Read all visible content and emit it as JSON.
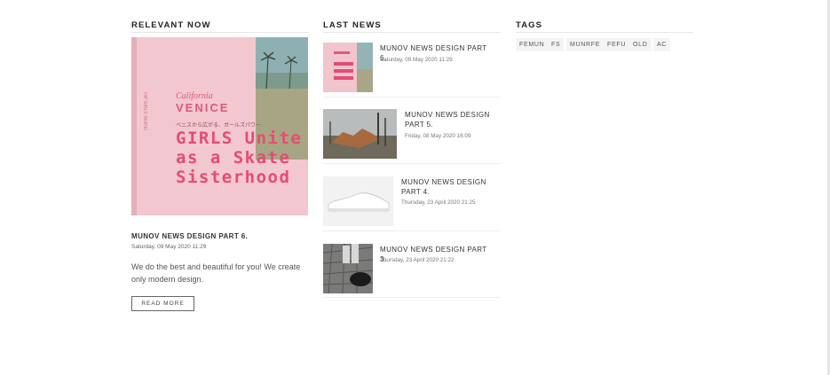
{
  "sections": {
    "relevant_title": "RELEVANT NOW",
    "last_news_title": "LAST NEWS",
    "tags_title": "TAGS"
  },
  "featured": {
    "image_text": {
      "city": "California",
      "venice": "VENICE",
      "sub": "ベニスから広がる、ガールズパワー",
      "headline": "GIRLS Unite\nas a Skate\nSisterhood",
      "side": "HIP GIRLS SKATE!"
    },
    "title": "MUNOV NEWS DESIGN PART 6.",
    "date": "Saturday, 09 May 2020 11:29",
    "excerpt": "We do the best and beautiful for you! We create only modern design.",
    "read_more": "READ MORE"
  },
  "news": [
    {
      "title": "MUNOV NEWS DESIGN PART 6.",
      "date": "Saturday, 09 May 2020 11:29"
    },
    {
      "title": "MUNOV NEWS DESIGN PART 5.",
      "date": "Friday, 08 May 2020 16:09"
    },
    {
      "title": "MUNOV NEWS DESIGN PART 4.",
      "date": "Thursday, 23 April 2020 21:25"
    },
    {
      "title": "MUNOV NEWS DESIGN PART 3.",
      "date": "Thursday, 23 April 2020 21:22"
    }
  ],
  "tags": [
    "FEMUN",
    "FS",
    "MUNRFE",
    "FEFU",
    "OLD",
    "AC"
  ]
}
